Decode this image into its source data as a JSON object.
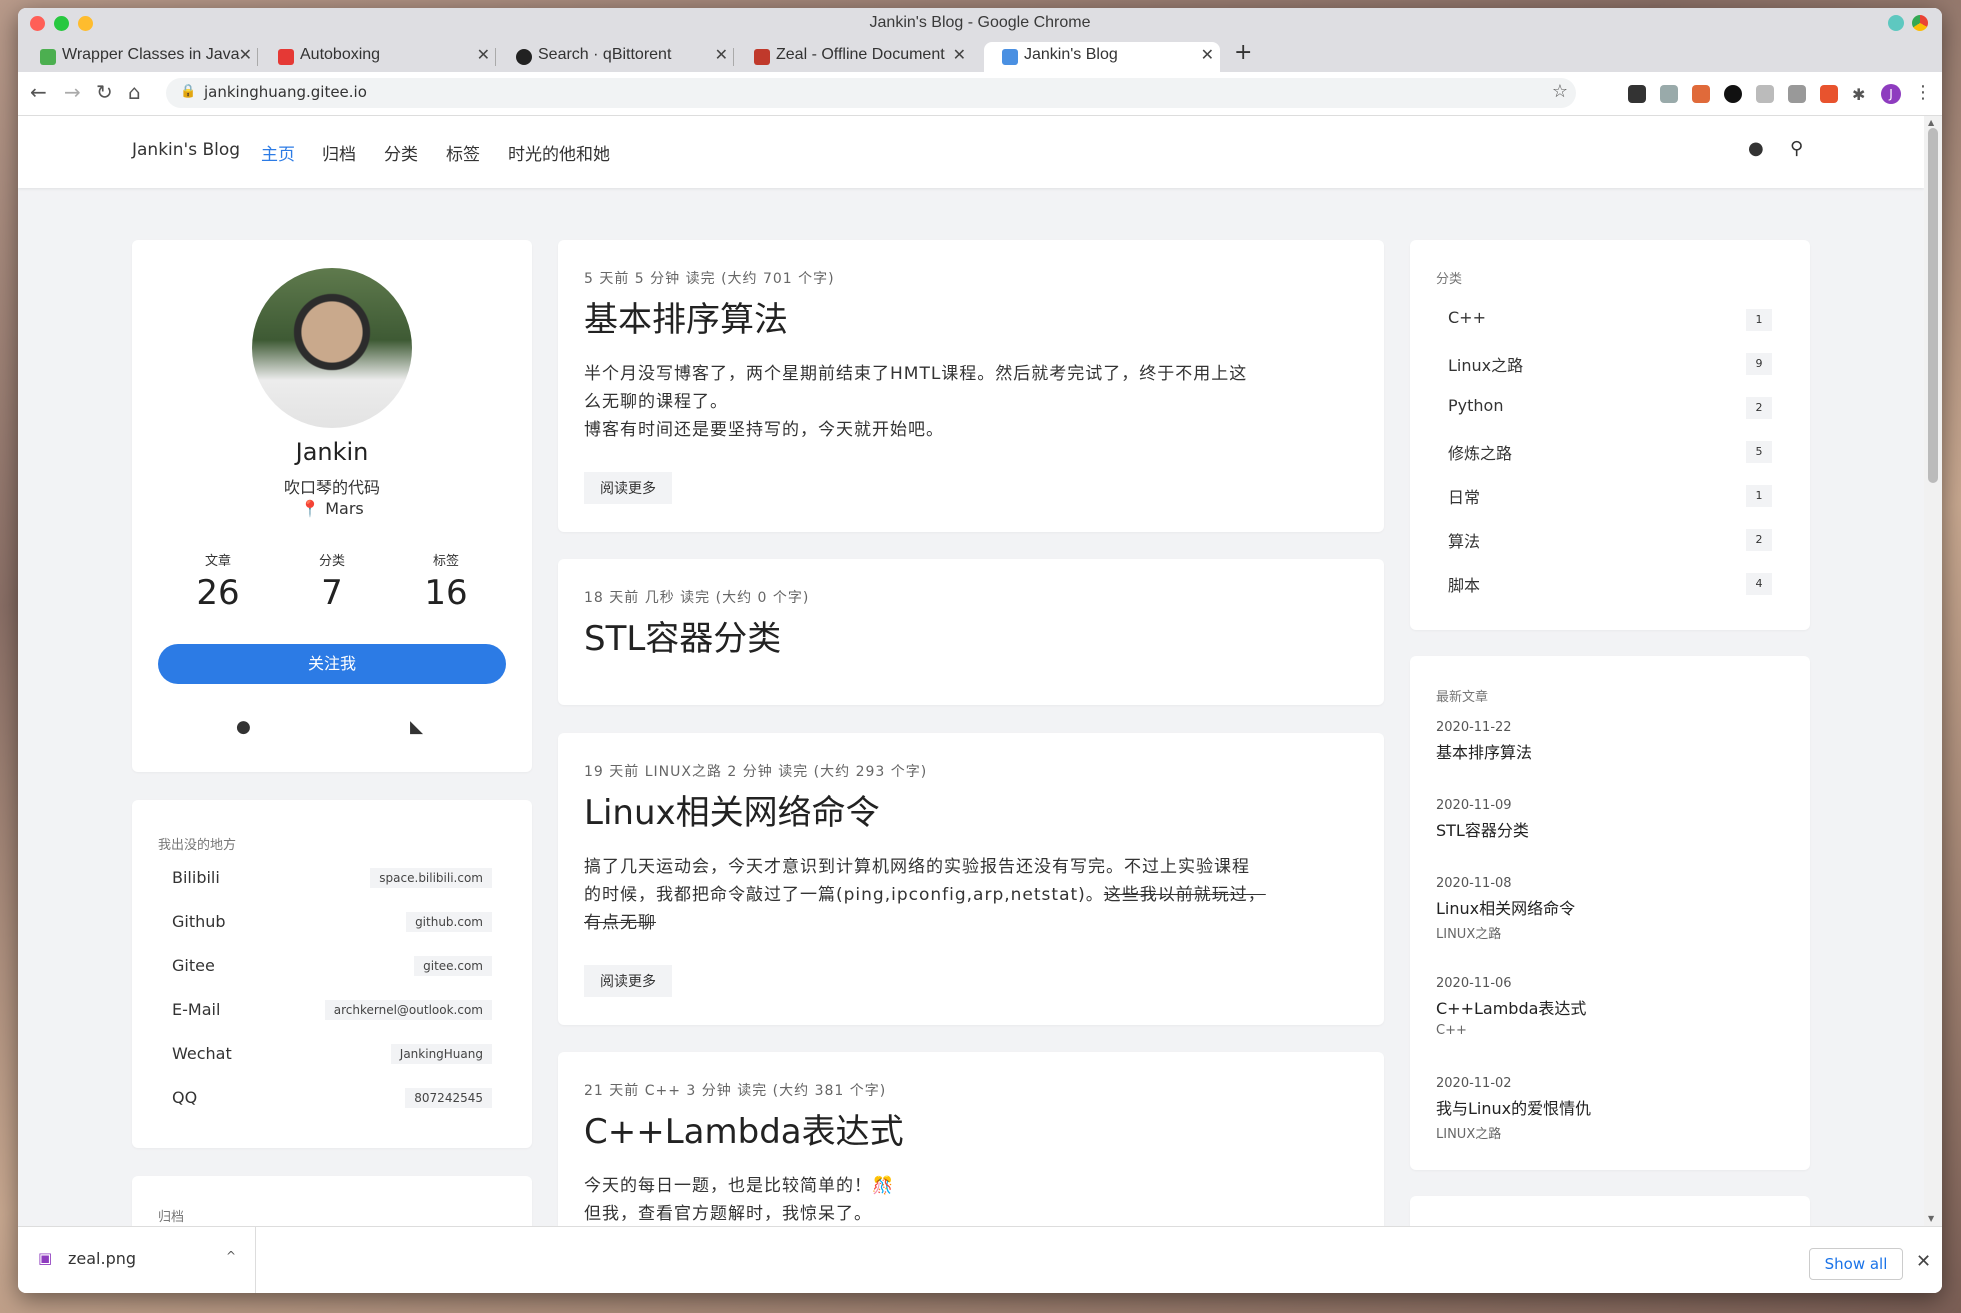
{
  "window": {
    "title": "Jankin's Blog - Google Chrome"
  },
  "tabs": [
    {
      "label": "Wrapper Classes in Java",
      "favicon_color": "#4caf50"
    },
    {
      "label": "Autoboxing",
      "favicon_color": "#e53935"
    },
    {
      "label": "Search · qBittorent",
      "favicon_color": "#222222"
    },
    {
      "label": "Zeal - Offline Document",
      "favicon_color": "#c0392b"
    },
    {
      "label": "Jankin's Blog",
      "favicon_color": "#4a90e2"
    }
  ],
  "toolbar": {
    "url": "jankinghuang.gitee.io",
    "profile_initial": "J"
  },
  "site": {
    "brand": "Jankin's Blog",
    "nav": [
      "主页",
      "归档",
      "分类",
      "标签",
      "时光的他和她"
    ]
  },
  "profile": {
    "name": "Jankin",
    "bio": "吹口琴的代码",
    "location": "Mars",
    "stats": [
      {
        "label": "文章",
        "value": "26"
      },
      {
        "label": "分类",
        "value": "7"
      },
      {
        "label": "标签",
        "value": "16"
      }
    ],
    "follow_label": "关注我"
  },
  "links_card": {
    "title": "我出没的地方",
    "items": [
      {
        "name": "Bilibili",
        "value": "space.bilibili.com"
      },
      {
        "name": "Github",
        "value": "github.com"
      },
      {
        "name": "Gitee",
        "value": "gitee.com"
      },
      {
        "name": "E-Mail",
        "value": "archkernel@outlook.com"
      },
      {
        "name": "Wechat",
        "value": "JankingHuang"
      },
      {
        "name": "QQ",
        "value": "807242545"
      }
    ]
  },
  "archive_card": {
    "title": "归档"
  },
  "posts": [
    {
      "meta": "5 天前  5 分钟 读完 (大约 701 个字)",
      "title": "基本排序算法",
      "excerpt_lines": [
        "半个月没写博客了，两个星期前结束了HMTL课程。然后就考完试了，终于不用上这",
        "么无聊的课程了。",
        "博客有时间还是要坚持写的，今天就开始吧。"
      ],
      "read_more": "阅读更多"
    },
    {
      "meta": "18 天前  几秒 读完 (大约 0 个字)",
      "title": "STL容器分类"
    },
    {
      "meta": "19 天前  LINUX之路  2 分钟 读完 (大约 293 个字)",
      "title": "Linux相关网络命令",
      "excerpt_line1": "搞了几天运动会，今天才意识到计算机网络的实验报告还没有写完。不过上实验课程",
      "excerpt_line2_plain": "的时候，我都把命令敲过了一篇(ping,ipconfig,arp,netstat)。",
      "excerpt_line2_strike": "这些我以前就玩过，",
      "excerpt_line3_strike": "有点无聊",
      "read_more": "阅读更多"
    },
    {
      "meta": "21 天前  C++  3 分钟 读完 (大约 381 个字)",
      "title": "C++Lambda表达式",
      "excerpt_lines": [
        "今天的每日一题，也是比较简单的！🎊",
        "但我，查看官方题解时，我惊呆了。"
      ]
    }
  ],
  "categories_card": {
    "title": "分类",
    "items": [
      {
        "name": "C++",
        "count": "1"
      },
      {
        "name": "Linux之路",
        "count": "9"
      },
      {
        "name": "Python",
        "count": "2"
      },
      {
        "name": "修炼之路",
        "count": "5"
      },
      {
        "name": "日常",
        "count": "1"
      },
      {
        "name": "算法",
        "count": "2"
      },
      {
        "name": "脚本",
        "count": "4"
      }
    ]
  },
  "recent_card": {
    "title": "最新文章",
    "items": [
      {
        "date": "2020-11-22",
        "title": "基本排序算法",
        "category": ""
      },
      {
        "date": "2020-11-09",
        "title": "STL容器分类",
        "category": ""
      },
      {
        "date": "2020-11-08",
        "title": "Linux相关网络命令",
        "category": "LINUX之路"
      },
      {
        "date": "2020-11-06",
        "title": "C++Lambda表达式",
        "category": "C++"
      },
      {
        "date": "2020-11-02",
        "title": "我与Linux的爱恨情仇",
        "category": "LINUX之路"
      }
    ]
  },
  "download_bar": {
    "file": "zeal.png",
    "show_all": "Show all"
  },
  "colors": {
    "accent": "#2c7be5",
    "page_bg": "#f2f3f5"
  }
}
